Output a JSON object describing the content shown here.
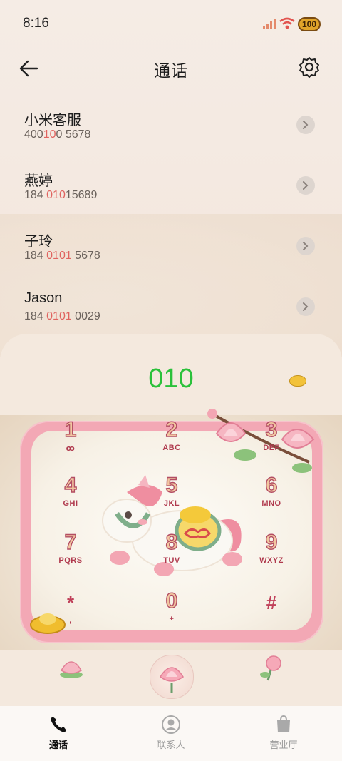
{
  "status_bar": {
    "time": "8:16",
    "battery": "100",
    "icons": [
      "signal-icon",
      "wifi-icon",
      "battery-icon"
    ]
  },
  "header": {
    "title": "通话",
    "back_icon": "arrow-left-icon",
    "settings_icon": "gear-icon"
  },
  "contacts": [
    {
      "name": "小米客服",
      "num_parts": [
        "400",
        "10",
        "0 5678"
      ],
      "num_layout": "400 100 5678"
    },
    {
      "name": "燕婷",
      "num_parts": [
        "184 ",
        "010",
        "15689"
      ]
    },
    {
      "name": "子玲",
      "num_parts": [
        "184 ",
        "0101",
        " 5678"
      ]
    },
    {
      "name": "Jason",
      "num_parts": [
        "184 ",
        "0101",
        " 0029"
      ]
    }
  ],
  "dialer": {
    "input": "010",
    "keys": [
      {
        "digit": "1",
        "letters": "ꝏ"
      },
      {
        "digit": "2",
        "letters": "ABC"
      },
      {
        "digit": "3",
        "letters": "DEF"
      },
      {
        "digit": "4",
        "letters": "GHI"
      },
      {
        "digit": "5",
        "letters": "JKL"
      },
      {
        "digit": "6",
        "letters": "MNO"
      },
      {
        "digit": "7",
        "letters": "PQRS"
      },
      {
        "digit": "8",
        "letters": "TUV"
      },
      {
        "digit": "9",
        "letters": "WXYZ"
      },
      {
        "digit": "*",
        "letters": ","
      },
      {
        "digit": "0",
        "letters": "+"
      },
      {
        "digit": "#",
        "letters": ""
      }
    ],
    "call_button_icon": "lotus-icon"
  },
  "bottom_nav": [
    {
      "label": "通话",
      "icon": "phone-icon",
      "active": true
    },
    {
      "label": "联系人",
      "icon": "person-icon",
      "active": false
    },
    {
      "label": "营业厅",
      "icon": "bag-icon",
      "active": false
    }
  ],
  "colors": {
    "digits_green": "#2bc13b",
    "highlight_red": "#e0635f",
    "key_stroke": "#b34d63"
  }
}
